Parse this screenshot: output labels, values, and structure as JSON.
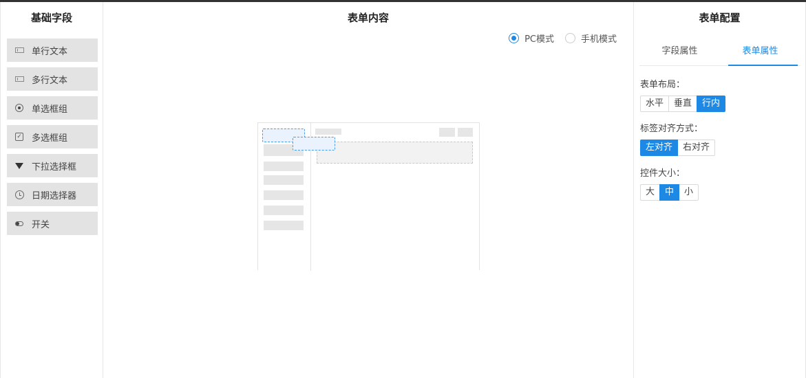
{
  "left": {
    "title": "基础字段",
    "fields": [
      {
        "label": "单行文本",
        "icon": "input-icon"
      },
      {
        "label": "多行文本",
        "icon": "textarea-icon"
      },
      {
        "label": "单选框组",
        "icon": "radio-icon"
      },
      {
        "label": "多选框组",
        "icon": "checkbox-icon"
      },
      {
        "label": "下拉选择框",
        "icon": "dropdown-triangle-icon"
      },
      {
        "label": "日期选择器",
        "icon": "clock-icon"
      },
      {
        "label": "开关",
        "icon": "toggle-icon"
      }
    ]
  },
  "center": {
    "title": "表单内容",
    "modes": [
      {
        "label": "PC模式",
        "selected": true
      },
      {
        "label": "手机模式",
        "selected": false
      }
    ]
  },
  "right": {
    "title": "表单配置",
    "tabs": [
      {
        "label": "字段属性",
        "active": false
      },
      {
        "label": "表单属性",
        "active": true
      }
    ],
    "layout": {
      "label": "表单布局：",
      "options": [
        "水平",
        "垂直",
        "行内"
      ],
      "selected": "行内"
    },
    "label_align": {
      "label": "标签对齐方式：",
      "options": [
        "左对齐",
        "右对齐"
      ],
      "selected": "左对齐"
    },
    "size": {
      "label": "控件大小：",
      "options": [
        "大",
        "中",
        "小"
      ],
      "selected": "中"
    }
  },
  "colors": {
    "accent": "#1e88e5",
    "field_bg": "#e3e3e3"
  }
}
